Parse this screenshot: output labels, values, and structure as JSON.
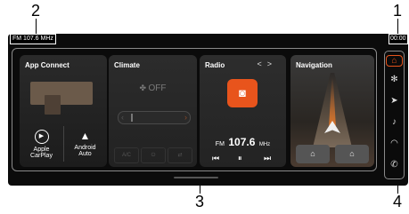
{
  "callouts": {
    "c1": "1",
    "c2": "2",
    "c3": "3",
    "c4": "4"
  },
  "status": {
    "left": "FM 107.6 MHz",
    "right": "00:00"
  },
  "app_connect": {
    "title": "App Connect",
    "apple": {
      "line1": "Apple",
      "line2": "CarPlay"
    },
    "android": {
      "line1": "Android",
      "line2": "Auto"
    }
  },
  "climate": {
    "title": "Climate",
    "state": "OFF",
    "btn_ac": "A/C",
    "btn_power": "⏻",
    "btn_recirc": "⇄"
  },
  "radio": {
    "title": "Radio",
    "prev": "<",
    "next": ">",
    "band": "FM",
    "frequency": "107.6",
    "unit": "MHz",
    "btn_prev": "⏮",
    "btn_pause": "⏸",
    "btn_next": "⏭"
  },
  "navigation": {
    "title": "Navigation",
    "btn_home": "⌂",
    "btn_work": "⌂"
  },
  "sidebar": {
    "home": "⌂",
    "fan": "✻",
    "nav": "➤",
    "music": "♪",
    "car": "◠",
    "phone": "✆"
  }
}
